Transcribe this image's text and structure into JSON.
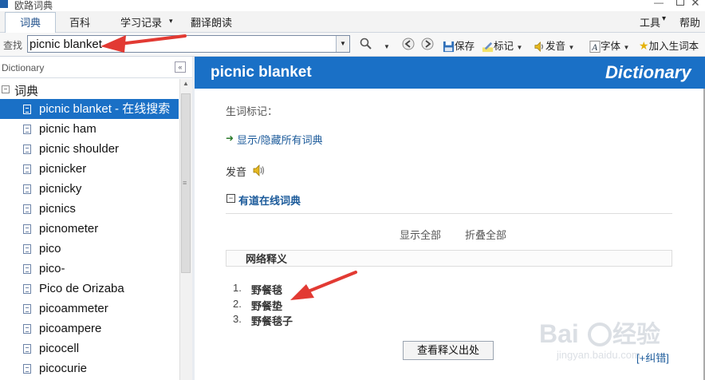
{
  "window": {
    "title": "欧路词典"
  },
  "menu": {
    "tabs": [
      "词典",
      "百科",
      "学习记录",
      "翻译朗读"
    ],
    "tools": "工具",
    "help": "帮助"
  },
  "toolbar": {
    "search_label": "查找",
    "search_value": "picnic blanket",
    "save": "保存",
    "mark": "标记",
    "pronounce": "发音",
    "font": "字体",
    "add_word": "加入生词本"
  },
  "left_panel": {
    "title": "Dictionary",
    "tree_root": "词典",
    "words": [
      "picnic blanket - 在线搜索",
      "picnic ham",
      "picnic shoulder",
      "picnicker",
      "picnicky",
      "picnics",
      "picnometer",
      "pico",
      "pico-",
      "Pico de Orizaba",
      "picoammeter",
      "picoampere",
      "picocell",
      "picocurie"
    ],
    "selected_index": 0
  },
  "content": {
    "headword": "picnic blanket",
    "brand": "Dictionary",
    "new_word_mark": "生词标记：",
    "toggle_all": "显示/隐藏所有词典",
    "pronunciation": "发音",
    "youdao_title": "有道在线词典",
    "show_all": "显示全部",
    "fold_all": "折叠全部",
    "web_def_title": "网络释义",
    "definitions": [
      {
        "num": "1.",
        "text": "野餐毯"
      },
      {
        "num": "2.",
        "text": "野餐垫"
      },
      {
        "num": "3.",
        "text": "野餐毯子"
      }
    ],
    "source_button": "查看释义出处",
    "more_link": "[+纠错]"
  },
  "colors": {
    "accent": "#1a70c6",
    "annotation": "#e23a33"
  }
}
